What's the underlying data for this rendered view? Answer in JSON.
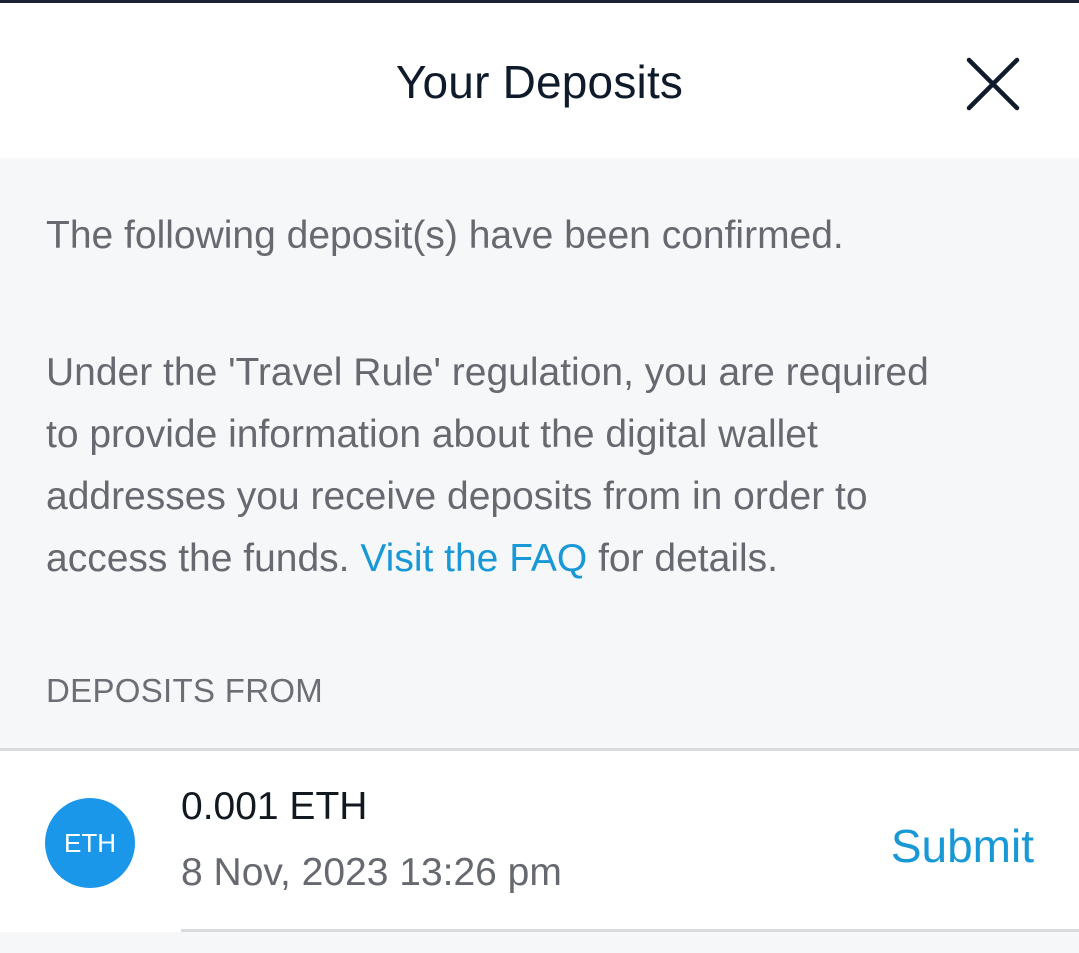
{
  "header": {
    "title": "Your Deposits",
    "close_icon": "close-icon"
  },
  "notice": {
    "confirmed_text": "The following deposit(s) have been confirmed.",
    "travel_rule_lines": [
      "Under the 'Travel Rule' regulation, you are required",
      "to provide information about the digital wallet",
      "addresses you receive deposits from in order to"
    ],
    "last_line_prefix": "access the funds. ",
    "faq_link": "Visit the FAQ",
    "last_line_suffix": " for details."
  },
  "deposits": {
    "section_label": "DEPOSITS FROM",
    "items": [
      {
        "coin_badge": "ETH",
        "amount": "0.001 ETH",
        "timestamp": "8 Nov, 2023 13:26 pm",
        "action_label": "Submit"
      }
    ]
  },
  "colors": {
    "accent": "#1998d6",
    "badge": "#1b97ea",
    "panel_background": "#f6f7f9",
    "text_muted": "#666a70",
    "text_dark": "#0f1a2b"
  }
}
